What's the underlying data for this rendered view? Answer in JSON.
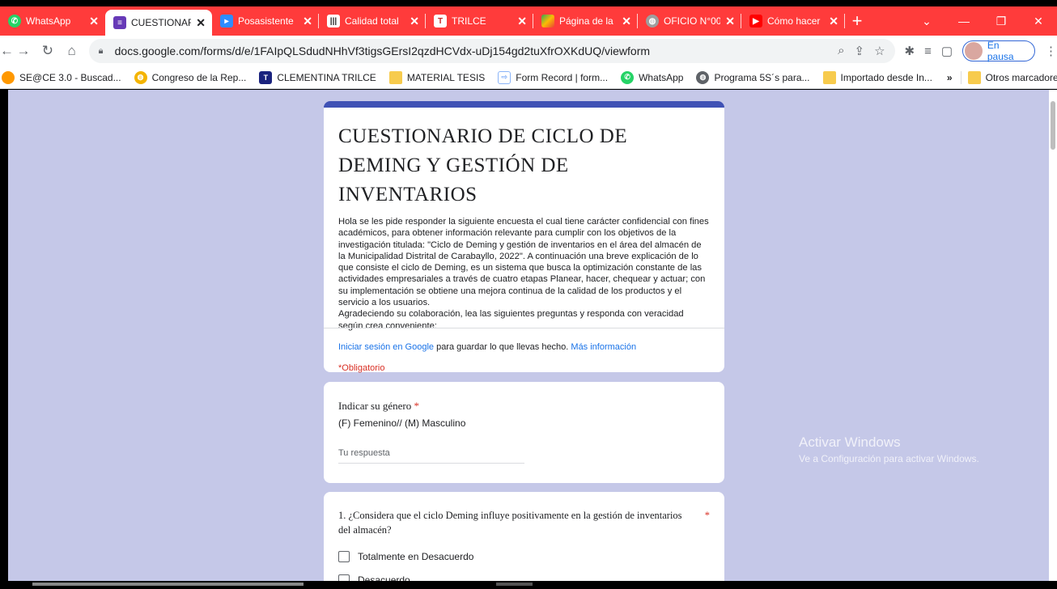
{
  "tabs": [
    {
      "title": "WhatsApp",
      "icon": "whatsapp-icon",
      "color": "#25d366",
      "active": false
    },
    {
      "title": "CUESTIONAR",
      "icon": "forms-icon",
      "color": "#673ab7",
      "active": true
    },
    {
      "title": "Posasistente",
      "icon": "zoom-icon",
      "color": "#2d8cff",
      "active": false
    },
    {
      "title": "Calidad total",
      "icon": "barcode-icon",
      "color": "#222222",
      "active": false
    },
    {
      "title": "TRILCE",
      "icon": "trilce-icon",
      "color": "#c62828",
      "active": false
    },
    {
      "title": "Página de la",
      "icon": "colorful-icon",
      "color": "#fbbc04",
      "active": false
    },
    {
      "title": "OFICIO N°00",
      "icon": "globe-icon",
      "color": "#9e9e9e",
      "active": false
    },
    {
      "title": "Cómo hacer",
      "icon": "youtube-icon",
      "color": "#ff0000",
      "active": false
    }
  ],
  "addressbar": {
    "url": "docs.google.com/forms/d/e/1FAIpQLSdudNHhVf3tigsGErsI2qzdHCVdx-uDj154gd2tuXfrOXKdUQ/viewform",
    "profile_label": "En pausa"
  },
  "bookmarks": [
    {
      "label": "SE@CE 3.0 - Buscad...",
      "icon": "seace-icon",
      "color": "#ff9800"
    },
    {
      "label": "Congreso de la Rep...",
      "icon": "congreso-icon",
      "color": "#f4b400"
    },
    {
      "label": "CLEMENTINA TRILCE",
      "icon": "trilce-icon",
      "color": "#1a237e"
    },
    {
      "label": "MATERIAL TESIS",
      "icon": "folder-icon",
      "color": "#f7cb4d"
    },
    {
      "label": "Form Record | form...",
      "icon": "form-record-icon",
      "color": "#8ab4f8"
    },
    {
      "label": "WhatsApp",
      "icon": "whatsapp-icon",
      "color": "#25d366"
    },
    {
      "label": "Programa 5S´s para...",
      "icon": "globe-icon",
      "color": "#5f6368"
    },
    {
      "label": "Importado desde In...",
      "icon": "folder-icon",
      "color": "#f7cb4d"
    }
  ],
  "bookmarks_other": "Otros marcadores",
  "form": {
    "title": "CUESTIONARIO DE CICLO DE DEMING Y GESTIÓN DE INVENTARIOS",
    "description": "Hola se les pide responder la siguiente encuesta el cual tiene carácter confidencial con fines académicos, para obtener información relevante para cumplir con los objetivos de la investigación titulada: \"Ciclo de Deming y gestión de inventarios en el área del almacén de la Municipalidad Distrital de Carabayllo, 2022\". A continuación una breve explicación de lo que consiste el ciclo de Deming, es un sistema que busca la optimización constante de las actividades empresariales a través de cuatro etapas Planear, hacer, chequear y actuar; con su implementación se obtiene una mejora continua de la calidad de los productos y el servicio a los usuarios.\nAgradeciendo su colaboración, lea las siguientes preguntas y responda con veracidad según crea conveniente:",
    "signin_link": "Iniciar sesión en Google",
    "signin_text": " para guardar lo que llevas hecho. ",
    "more_info": "Más información",
    "required_note": "*Obligatorio",
    "q_gender": {
      "title": "Indicar su género",
      "star": "*",
      "description": "(F) Femenino// (M) Masculino",
      "placeholder": "Tu respuesta"
    },
    "q1": {
      "title": "1. ¿Considera que el ciclo Deming influye positivamente en la gestión de inventarios del almacén?",
      "star": "*",
      "options": [
        "Totalmente en Desacuerdo",
        "Desacuerdo"
      ]
    }
  },
  "watermark": {
    "line1": "Activar Windows",
    "line2": "Ve a Configuración para activar Windows."
  }
}
